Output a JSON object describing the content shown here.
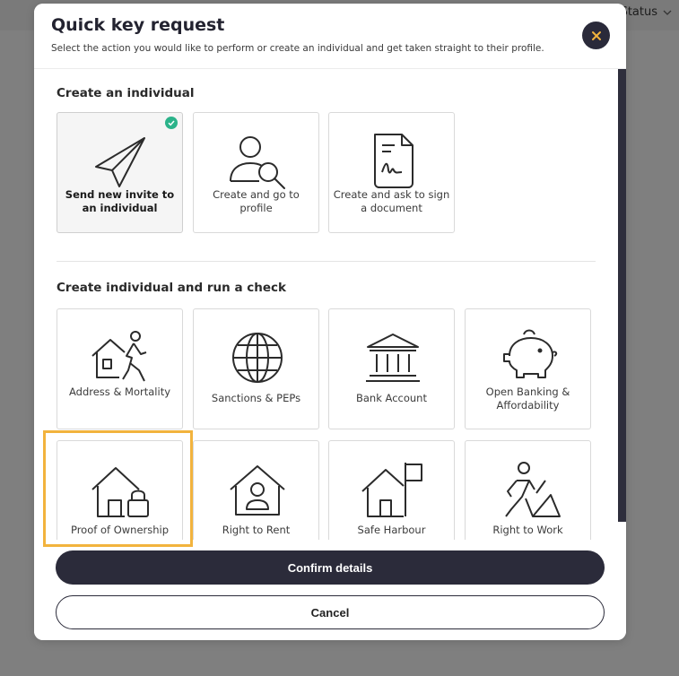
{
  "background": {
    "status_label": "Status"
  },
  "modal": {
    "title": "Quick key request",
    "subtitle": "Select the action you would like to perform or create an individual and get taken straight to their profile."
  },
  "sections": {
    "create": {
      "title": "Create an individual",
      "cards": [
        {
          "label": "Send new invite to an individual",
          "icon": "paper-plane-icon",
          "selected": true
        },
        {
          "label": "Create and go to profile",
          "icon": "user-search-icon",
          "selected": false
        },
        {
          "label": "Create and ask to sign a document",
          "icon": "document-signature-icon",
          "selected": false
        }
      ]
    },
    "checks": {
      "title": "Create individual and run a check",
      "cards": [
        {
          "label": "Address & Mortality",
          "icon": "house-person-icon"
        },
        {
          "label": "Sanctions & PEPs",
          "icon": "globe-icon"
        },
        {
          "label": "Bank Account",
          "icon": "bank-icon"
        },
        {
          "label": "Open Banking & Affordability",
          "icon": "piggy-bank-icon"
        },
        {
          "label": "Proof of Ownership",
          "icon": "house-lock-icon"
        },
        {
          "label": "Right to Rent",
          "icon": "house-tenant-icon"
        },
        {
          "label": "Safe Harbour",
          "icon": "house-flag-icon"
        },
        {
          "label": "Right to Work",
          "icon": "worker-icon"
        }
      ]
    }
  },
  "actions": {
    "confirm_label": "Confirm details",
    "cancel_label": "Cancel"
  },
  "colors": {
    "primary_dark": "#2b2b3a",
    "close_x": "#f2b33d",
    "check_badge": "#2bb38a",
    "highlight": "#f2b33d"
  }
}
